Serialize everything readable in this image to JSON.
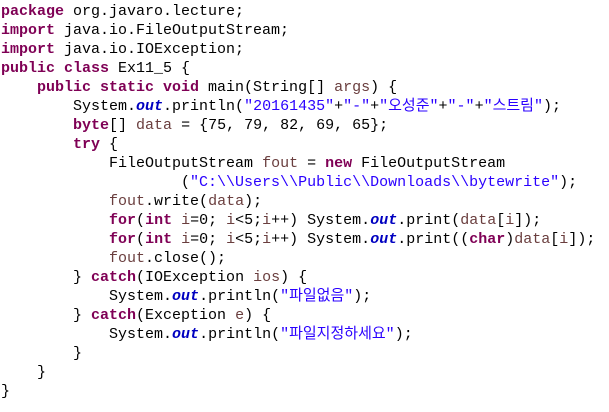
{
  "colors": {
    "keyword": "#7f0055",
    "string": "#2a00ff",
    "field": "#0000c0",
    "variable": "#6a3e3e"
  },
  "lines": [
    {
      "indent": 0,
      "tokens": [
        {
          "t": "package",
          "c": "kw"
        },
        {
          "t": " org.javaro.lecture;",
          "c": "pl"
        }
      ]
    },
    {
      "indent": 0,
      "tokens": [
        {
          "t": "import",
          "c": "kw"
        },
        {
          "t": " java.io.FileOutputStream;",
          "c": "pl"
        }
      ]
    },
    {
      "indent": 0,
      "tokens": [
        {
          "t": "import",
          "c": "kw"
        },
        {
          "t": " java.io.IOException;",
          "c": "pl"
        }
      ]
    },
    {
      "indent": 0,
      "tokens": [
        {
          "t": "public class",
          "c": "kw"
        },
        {
          "t": " Ex11_5 {",
          "c": "pl"
        }
      ]
    },
    {
      "indent": 1,
      "tokens": [
        {
          "t": "public static void",
          "c": "kw"
        },
        {
          "t": " main(String[] ",
          "c": "pl"
        },
        {
          "t": "args",
          "c": "var"
        },
        {
          "t": ") {",
          "c": "pl"
        }
      ]
    },
    {
      "indent": 2,
      "tokens": [
        {
          "t": "System.",
          "c": "pl"
        },
        {
          "t": "out",
          "c": "fld"
        },
        {
          "t": ".println(",
          "c": "pl"
        },
        {
          "t": "\"20161435\"",
          "c": "str"
        },
        {
          "t": "+",
          "c": "pl"
        },
        {
          "t": "\"-\"",
          "c": "str"
        },
        {
          "t": "+",
          "c": "pl"
        },
        {
          "t": "\"오성준\"",
          "c": "str"
        },
        {
          "t": "+",
          "c": "pl"
        },
        {
          "t": "\"-\"",
          "c": "str"
        },
        {
          "t": "+",
          "c": "pl"
        },
        {
          "t": "\"스트림\"",
          "c": "str"
        },
        {
          "t": ");",
          "c": "pl"
        }
      ]
    },
    {
      "indent": 2,
      "tokens": [
        {
          "t": "byte",
          "c": "kw"
        },
        {
          "t": "[] ",
          "c": "pl"
        },
        {
          "t": "data",
          "c": "var"
        },
        {
          "t": " = {75, 79, 82, 69, 65};",
          "c": "pl"
        }
      ]
    },
    {
      "indent": 2,
      "tokens": [
        {
          "t": "try",
          "c": "kw"
        },
        {
          "t": " {",
          "c": "pl"
        }
      ]
    },
    {
      "indent": 3,
      "tokens": [
        {
          "t": "FileOutputStream ",
          "c": "pl"
        },
        {
          "t": "fout",
          "c": "var"
        },
        {
          "t": " = ",
          "c": "pl"
        },
        {
          "t": "new",
          "c": "kw"
        },
        {
          "t": " FileOutputStream",
          "c": "pl"
        }
      ]
    },
    {
      "indent": 5,
      "tokens": [
        {
          "t": "(",
          "c": "pl"
        },
        {
          "t": "\"C:\\\\Users\\\\Public\\\\Downloads\\\\bytewrite\"",
          "c": "str"
        },
        {
          "t": ");",
          "c": "pl"
        }
      ]
    },
    {
      "indent": 3,
      "tokens": [
        {
          "t": "fout",
          "c": "var"
        },
        {
          "t": ".write(",
          "c": "pl"
        },
        {
          "t": "data",
          "c": "var"
        },
        {
          "t": ");",
          "c": "pl"
        }
      ]
    },
    {
      "indent": 3,
      "tokens": [
        {
          "t": "for",
          "c": "kw"
        },
        {
          "t": "(",
          "c": "pl"
        },
        {
          "t": "int",
          "c": "kw"
        },
        {
          "t": " ",
          "c": "pl"
        },
        {
          "t": "i",
          "c": "var"
        },
        {
          "t": "=0; ",
          "c": "pl"
        },
        {
          "t": "i",
          "c": "var"
        },
        {
          "t": "<5;",
          "c": "pl"
        },
        {
          "t": "i",
          "c": "var"
        },
        {
          "t": "++) System.",
          "c": "pl"
        },
        {
          "t": "out",
          "c": "fld"
        },
        {
          "t": ".print(",
          "c": "pl"
        },
        {
          "t": "data",
          "c": "var"
        },
        {
          "t": "[",
          "c": "pl"
        },
        {
          "t": "i",
          "c": "var"
        },
        {
          "t": "]);",
          "c": "pl"
        }
      ]
    },
    {
      "indent": 3,
      "tokens": [
        {
          "t": "for",
          "c": "kw"
        },
        {
          "t": "(",
          "c": "pl"
        },
        {
          "t": "int",
          "c": "kw"
        },
        {
          "t": " ",
          "c": "pl"
        },
        {
          "t": "i",
          "c": "var"
        },
        {
          "t": "=0; ",
          "c": "pl"
        },
        {
          "t": "i",
          "c": "var"
        },
        {
          "t": "<5;",
          "c": "pl"
        },
        {
          "t": "i",
          "c": "var"
        },
        {
          "t": "++) System.",
          "c": "pl"
        },
        {
          "t": "out",
          "c": "fld"
        },
        {
          "t": ".print((",
          "c": "pl"
        },
        {
          "t": "char",
          "c": "kw"
        },
        {
          "t": ")",
          "c": "pl"
        },
        {
          "t": "data",
          "c": "var"
        },
        {
          "t": "[",
          "c": "pl"
        },
        {
          "t": "i",
          "c": "var"
        },
        {
          "t": "]);",
          "c": "pl"
        }
      ]
    },
    {
      "indent": 3,
      "tokens": [
        {
          "t": "fout",
          "c": "var"
        },
        {
          "t": ".close();",
          "c": "pl"
        }
      ]
    },
    {
      "indent": 2,
      "tokens": [
        {
          "t": "} ",
          "c": "pl"
        },
        {
          "t": "catch",
          "c": "kw"
        },
        {
          "t": "(IOException ",
          "c": "pl"
        },
        {
          "t": "ios",
          "c": "var"
        },
        {
          "t": ") {",
          "c": "pl"
        }
      ]
    },
    {
      "indent": 3,
      "tokens": [
        {
          "t": "System.",
          "c": "pl"
        },
        {
          "t": "out",
          "c": "fld"
        },
        {
          "t": ".println(",
          "c": "pl"
        },
        {
          "t": "\"파일없음\"",
          "c": "str"
        },
        {
          "t": ");",
          "c": "pl"
        }
      ]
    },
    {
      "indent": 2,
      "tokens": [
        {
          "t": "} ",
          "c": "pl"
        },
        {
          "t": "catch",
          "c": "kw"
        },
        {
          "t": "(Exception ",
          "c": "pl"
        },
        {
          "t": "e",
          "c": "var"
        },
        {
          "t": ") {",
          "c": "pl"
        }
      ]
    },
    {
      "indent": 3,
      "tokens": [
        {
          "t": "System.",
          "c": "pl"
        },
        {
          "t": "out",
          "c": "fld"
        },
        {
          "t": ".println(",
          "c": "pl"
        },
        {
          "t": "\"파일지정하세요\"",
          "c": "str"
        },
        {
          "t": ");",
          "c": "pl"
        }
      ]
    },
    {
      "indent": 2,
      "tokens": [
        {
          "t": "}",
          "c": "pl"
        }
      ]
    },
    {
      "indent": 1,
      "tokens": [
        {
          "t": "}",
          "c": "pl"
        }
      ]
    },
    {
      "indent": 0,
      "tokens": [
        {
          "t": "}",
          "c": "pl"
        }
      ]
    }
  ]
}
